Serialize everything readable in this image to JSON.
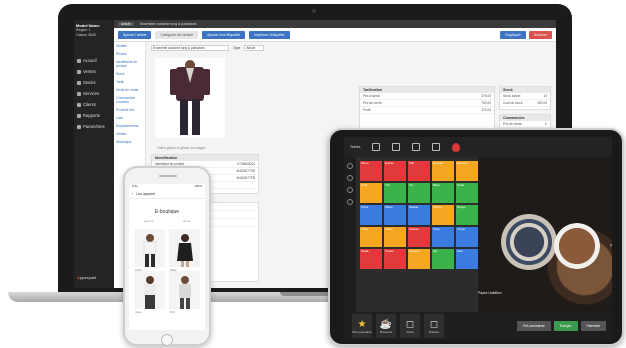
{
  "laptop": {
    "sidebar": {
      "user_name": "Model Name",
      "user_line2": "Region 1",
      "user_line3": "Caisse 3640",
      "nav": [
        "Accueil",
        "Ventes",
        "Stocks",
        "Services",
        "Clients",
        "Rapports",
        "Paramètres"
      ],
      "brand_prefix": "A",
      "brand_rest": "ppsepaid"
    },
    "topbar": {
      "tab_label": "Article",
      "breadcrumb": "Ensemble costume long & pantalons"
    },
    "toolbar": {
      "add_button": "Ajouter l'article",
      "tab2": "Catégorie de l'article",
      "tab3": "Ajouter à la étiquette",
      "tab4": "Imprimer l'étiquette",
      "duplicate_button": "Dupliquer",
      "delete_button": "Archiver"
    },
    "subnav": [
      "Modèle",
      "Photos",
      "Identifiants du produit",
      "Stock",
      "Tarifs",
      "Mode de vente",
      "Commandes ouvertes",
      "Produits lies",
      "Liste",
      "Emplacements",
      "Ventes",
      "Historique"
    ],
    "product": {
      "name": "Ensemble costume long & pantalons",
      "type_label": "Type",
      "type_value": "Article",
      "image_caption": "Faites glisser et glisser les images"
    },
    "identification": {
      "title": "Identification",
      "rows": [
        {
          "k": "Identifiant du produit",
          "v": "0706860004"
        },
        {
          "k": "SUIF",
          "v": "M4D6B77EB"
        },
        {
          "k": "Code",
          "v": "M4D6B77EB"
        },
        {
          "k": "Code personnalisé",
          "v": ""
        }
      ]
    },
    "pricing": {
      "title": "Tarification",
      "rows": [
        {
          "k": "Prix d'achat",
          "v": "375,00"
        },
        {
          "k": "Prix de vente",
          "v": "750,00"
        },
        {
          "k": "Profit",
          "v": "375,00"
        }
      ]
    },
    "stock": {
      "title": "Stock",
      "rows": [
        {
          "k": "Stock actuel",
          "v": "10"
        },
        {
          "k": "Coût du stock",
          "v": "350,00"
        }
      ]
    },
    "comments": {
      "title": "Commandes",
      "rows": [
        {
          "k": "Prix de vente",
          "v": "0"
        },
        {
          "k": "Commandes",
          "v": "0"
        },
        {
          "k": "Ventes annuelles",
          "v": "0"
        }
      ]
    },
    "defaults": {
      "title": "Valeurs par défaut des ventes",
      "rows": [
        {
          "k": "Code par défaut",
          "v": ""
        },
        {
          "k": "Emplacement",
          "v": ""
        },
        {
          "k": "Unité",
          "v": ""
        },
        {
          "k": "Spécification",
          "v": ""
        }
      ]
    },
    "sales_mode": {
      "title": "Mode de vente",
      "rows": [
        "Prix de la boutique",
        "Mode de vente",
        "Paiement",
        "Montant",
        "Mode de paiement",
        "Modal liquide",
        "Montant avance"
      ]
    }
  },
  "phone": {
    "status_time": "9:41",
    "status_right": "100%",
    "back_label": "Les apparel",
    "title": "E-boutique",
    "sub_left": "gauche",
    "sub_right": "droite",
    "cards": [
      "Tshirt",
      "Robe",
      "Jupe",
      "Pull"
    ]
  },
  "tablet": {
    "topbar_label": "Tables",
    "tabs": [
      "Nouvelle",
      "Table",
      "Commandes",
      "Favori"
    ],
    "tile_labels": [
      "Menu",
      "Entrée",
      "Plat",
      "Dessert",
      "Boisson",
      "Café",
      "Thé",
      "Vin",
      "Bière",
      "Soda",
      "Pizza",
      "Pâtes",
      "Salade",
      "Soupe",
      "Burger",
      "Frites",
      "Glace",
      "Gâteau",
      "Tarte",
      "Crêpe",
      "Steak",
      "Poulet",
      "Poisson",
      "Riz",
      "Pain"
    ],
    "tile_colors": [
      "#e23a3a",
      "#e23a3a",
      "#e23a3a",
      "#f5a623",
      "#f5a623",
      "#f5a623",
      "#3bb34a",
      "#3bb34a",
      "#3bb34a",
      "#3bb34a",
      "#3a7be0",
      "#3a7be0",
      "#3a7be0",
      "#f5a623",
      "#3bb34a",
      "#f5a623",
      "#f5a623",
      "#e23a3a",
      "#3a7be0",
      "#3a7be0",
      "#e23a3a",
      "#e23a3a",
      "#f5a623",
      "#3bb34a",
      "#3a7be0"
    ],
    "bottom_tabs": [
      {
        "label": "Plus populaire",
        "glyph": "★"
      },
      {
        "label": "Boissons",
        "glyph": "☕"
      },
      {
        "label": "Vente",
        "glyph": "◻"
      },
      {
        "label": "Entrées",
        "glyph": "◻"
      }
    ],
    "overlay_text": "Payez l'addition",
    "actions": [
      "Pré-commande",
      "Envoyer",
      "Paiement"
    ]
  }
}
